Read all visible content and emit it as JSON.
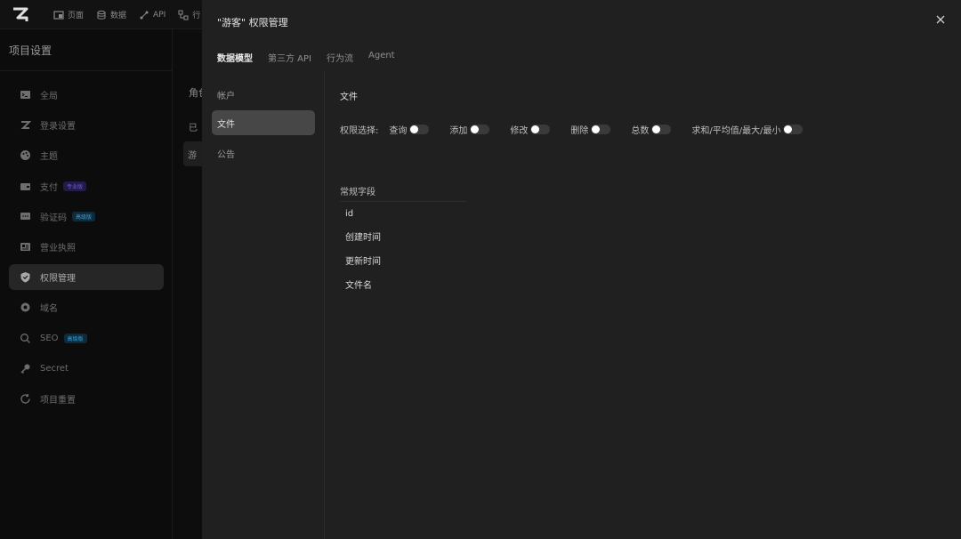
{
  "app": {
    "topnav": [
      {
        "label": "页面",
        "icon": "page-icon"
      },
      {
        "label": "数据",
        "icon": "database-icon"
      },
      {
        "label": "API",
        "icon": "api-icon"
      },
      {
        "label": "行",
        "icon": "flow-icon"
      }
    ],
    "sidebar": {
      "title": "项目设置",
      "items": [
        {
          "label": "全局",
          "icon": "terminal-icon"
        },
        {
          "label": "登录设置",
          "icon": "z-logo-icon"
        },
        {
          "label": "主题",
          "icon": "palette-icon"
        },
        {
          "label": "支付",
          "icon": "wallet-icon",
          "badge": "专业版"
        },
        {
          "label": "验证码",
          "icon": "message-icon",
          "badge": "高级版"
        },
        {
          "label": "营业执照",
          "icon": "id-card-icon"
        },
        {
          "label": "权限管理",
          "icon": "shield-check-icon",
          "active": true
        },
        {
          "label": "域名",
          "icon": "globe-icon"
        },
        {
          "label": "SEO",
          "icon": "search-icon",
          "badge": "高级版"
        },
        {
          "label": "Secret",
          "icon": "key-icon"
        },
        {
          "label": "项目重置",
          "icon": "refresh-icon"
        }
      ]
    },
    "peek": {
      "heading": "角色",
      "subheading": "已",
      "chip": "游"
    }
  },
  "dialog": {
    "title": "\"游客\" 权限管理",
    "tabs": [
      {
        "label": "数据模型",
        "active": true
      },
      {
        "label": "第三方 API"
      },
      {
        "label": "行为流"
      },
      {
        "label": "Agent"
      }
    ],
    "models": [
      {
        "label": "帐户"
      },
      {
        "label": "文件",
        "active": true
      },
      {
        "label": "公告"
      }
    ],
    "content": {
      "section_title": "文件",
      "permission_label": "权限选择:",
      "permissions": [
        {
          "label": "查询",
          "enabled": false
        },
        {
          "label": "添加",
          "enabled": false
        },
        {
          "label": "修改",
          "enabled": false
        },
        {
          "label": "删除",
          "enabled": false
        },
        {
          "label": "总数",
          "enabled": false
        },
        {
          "label": "求和/平均值/最大/最小",
          "enabled": false
        }
      ],
      "fields_title": "常规字段",
      "fields": [
        "id",
        "创建时间",
        "更新时间",
        "文件名"
      ]
    }
  }
}
